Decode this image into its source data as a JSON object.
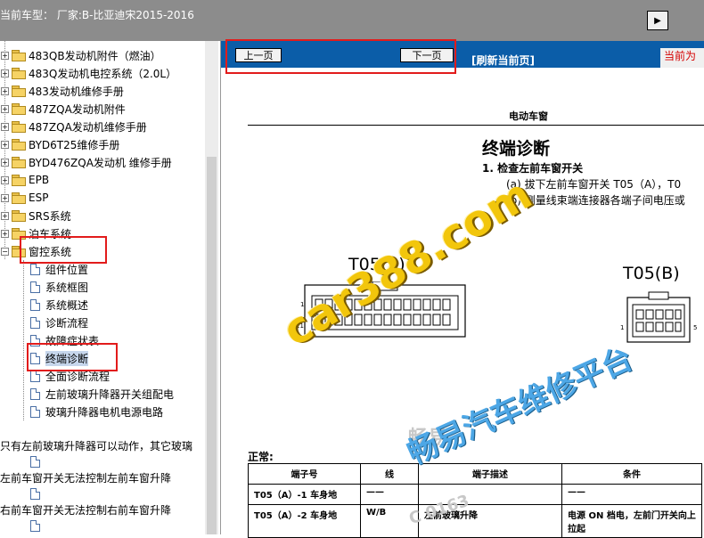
{
  "header": {
    "title": "当前车型：  厂家:B-比亚迪宋2015-2016",
    "toggle_icon": "arrow-right-icon"
  },
  "tree": {
    "folders": [
      "483QB发动机附件（燃油）",
      "483Q发动机电控系统（2.0L）",
      "483发动机维修手册",
      "487ZQA发动机附件",
      "487ZQA发动机维修手册",
      "BYD6T25维修手册",
      "BYD476ZQA发动机 维修手册",
      "EPB",
      "ESP",
      "SRS系统",
      "泊车系统"
    ],
    "open_folder": "窗控系统",
    "children": [
      "组件位置",
      "系统框图",
      "系统概述",
      "诊断流程",
      "故障症状表",
      "终端诊断",
      "全面诊断流程",
      "左前玻璃升降器开关组配电",
      "玻璃升降器电机电源电路"
    ],
    "selected_child": "终端诊断",
    "long_items": [
      "只有左前玻璃升降器可以动作，其它玻璃",
      "左前车窗开关无法控制左前车窗升降",
      "右前车窗开关无法控制右前车窗升降"
    ]
  },
  "viewer": {
    "prev_label": "上一页",
    "next_label": "下一页",
    "refresh_label": "[刷新当前页]",
    "current_label": "当前为",
    "doc": {
      "section": "电动车窗",
      "heading": "终端诊断",
      "step1": "1.    检查左前车窗开关",
      "sub_a": "(a)   拔下左前车窗开关 T05（A），T0",
      "sub_b": "(b)   测量线束端连接器各端子间电压或",
      "conn_a": "T05(A)",
      "conn_b": "T05(B)",
      "pin_1": "1",
      "pin_11": "11",
      "pin_b1": "1",
      "pin_b5": "5",
      "normal": "正常:",
      "table_headers": [
        "端子号",
        "线",
        "端子描述",
        "条件"
      ],
      "rows": [
        [
          "T05（A）-1 车身地",
          "——",
          "",
          "——"
        ],
        [
          "T05（A）-2 车身地",
          "W/B",
          "左前玻璃升降",
          "电源 ON 档电，左前门开关向上拉起"
        ]
      ]
    }
  },
  "watermarks": {
    "site": "car388.com",
    "platform": "畅易汽车维修平台",
    "grey1": "畅易",
    "grey2": "C 0163"
  },
  "colors": {
    "nav_bg": "#0b5da8",
    "highlight": "#e21b1b",
    "watermark_yellow": "#f2c60c"
  }
}
